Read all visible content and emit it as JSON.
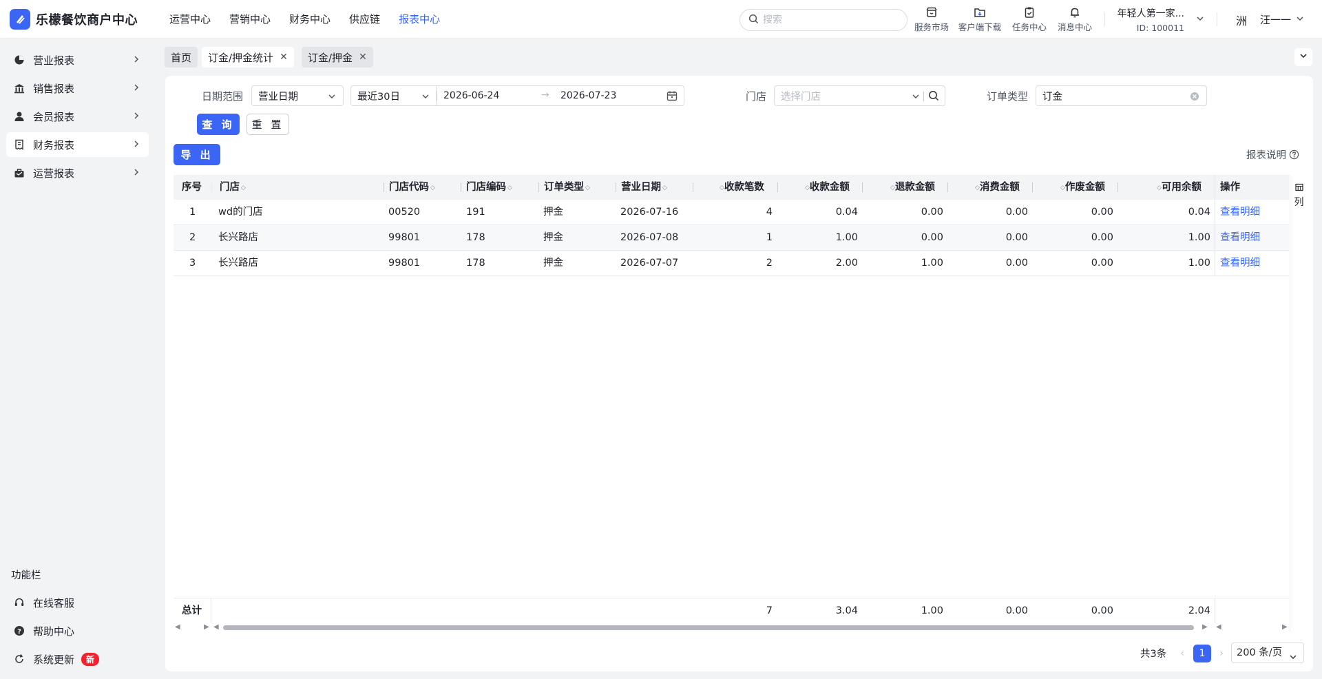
{
  "app": {
    "title": "乐檬餐饮商户中心",
    "nav": [
      "运营中心",
      "营销中心",
      "财务中心",
      "供应链",
      "报表中心"
    ],
    "active_nav_index": 4,
    "accent_color": "#3b66f5"
  },
  "header": {
    "search_placeholder": "搜索",
    "tools": [
      {
        "label": "服务市场",
        "icon": "store-icon"
      },
      {
        "label": "客户端下载",
        "icon": "folder-download-icon"
      },
      {
        "label": "任务中心",
        "icon": "clipboard-check-icon"
      },
      {
        "label": "消息中心",
        "icon": "bell-icon"
      }
    ],
    "account_name": "年轻人第一家...",
    "account_id": "ID: 100011",
    "avatar_text": "洲",
    "user_name": "汪一一"
  },
  "sidebar": {
    "items": [
      {
        "label": "营业报表",
        "icon": "chart-pie-icon"
      },
      {
        "label": "销售报表",
        "icon": "bank-icon"
      },
      {
        "label": "会员报表",
        "icon": "user-icon"
      },
      {
        "label": "财务报表",
        "icon": "receipt-icon"
      },
      {
        "label": "运营报表",
        "icon": "briefcase-icon"
      }
    ],
    "active_index": 3,
    "section_title": "功能栏",
    "bottom_items": [
      {
        "label": "在线客服",
        "icon": "headset-icon"
      },
      {
        "label": "帮助中心",
        "icon": "help-icon"
      },
      {
        "label": "系统更新",
        "icon": "refresh-icon",
        "badge": "新"
      }
    ]
  },
  "tabs": [
    {
      "label": "首页",
      "closable": false
    },
    {
      "label": "订金/押金统计",
      "closable": true,
      "active": true
    },
    {
      "label": "订金/押金",
      "closable": true
    }
  ],
  "filters": {
    "date_range_label": "日期范围",
    "date_type": "营业日期",
    "preset": "最近30日",
    "start_date": "2026-06-24",
    "end_date": "2026-07-23",
    "store_label": "门店",
    "store_placeholder": "选择门店",
    "order_type_label": "订单类型",
    "order_type_value": "订金",
    "query_button": "查 询",
    "reset_button": "重 置"
  },
  "export_button": "导 出",
  "report_help": "报表说明",
  "table": {
    "columns": [
      "序号",
      "门店",
      "门店代码",
      "门店编码",
      "订单类型",
      "营业日期",
      "收款笔数",
      "收款金额",
      "退款金额",
      "消费金额",
      "作废金额",
      "可用余额",
      "操作"
    ],
    "rows": [
      {
        "no": "1",
        "store": "wd的门店",
        "store_code": "00520",
        "store_no": "191",
        "order_type": "押金",
        "date": "2026-07-16",
        "count": "4",
        "received": "0.04",
        "refunded": "0.00",
        "consumed": "0.00",
        "voided": "0.00",
        "balance": "0.04",
        "action": "查看明细"
      },
      {
        "no": "2",
        "store": "长兴路店",
        "store_code": "99801",
        "store_no": "178",
        "order_type": "押金",
        "date": "2026-07-08",
        "count": "1",
        "received": "1.00",
        "refunded": "0.00",
        "consumed": "0.00",
        "voided": "0.00",
        "balance": "1.00",
        "action": "查看明细"
      },
      {
        "no": "3",
        "store": "长兴路店",
        "store_code": "99801",
        "store_no": "178",
        "order_type": "押金",
        "date": "2026-07-07",
        "count": "2",
        "received": "2.00",
        "refunded": "1.00",
        "consumed": "0.00",
        "voided": "0.00",
        "balance": "1.00",
        "action": "查看明细"
      }
    ],
    "summary": {
      "label": "总计",
      "count": "7",
      "received": "3.04",
      "refunded": "1.00",
      "consumed": "0.00",
      "voided": "0.00",
      "balance": "2.04"
    },
    "column_toggle": "列"
  },
  "pagination": {
    "total": "共3条",
    "current_page": "1",
    "page_size": "200 条/页"
  }
}
